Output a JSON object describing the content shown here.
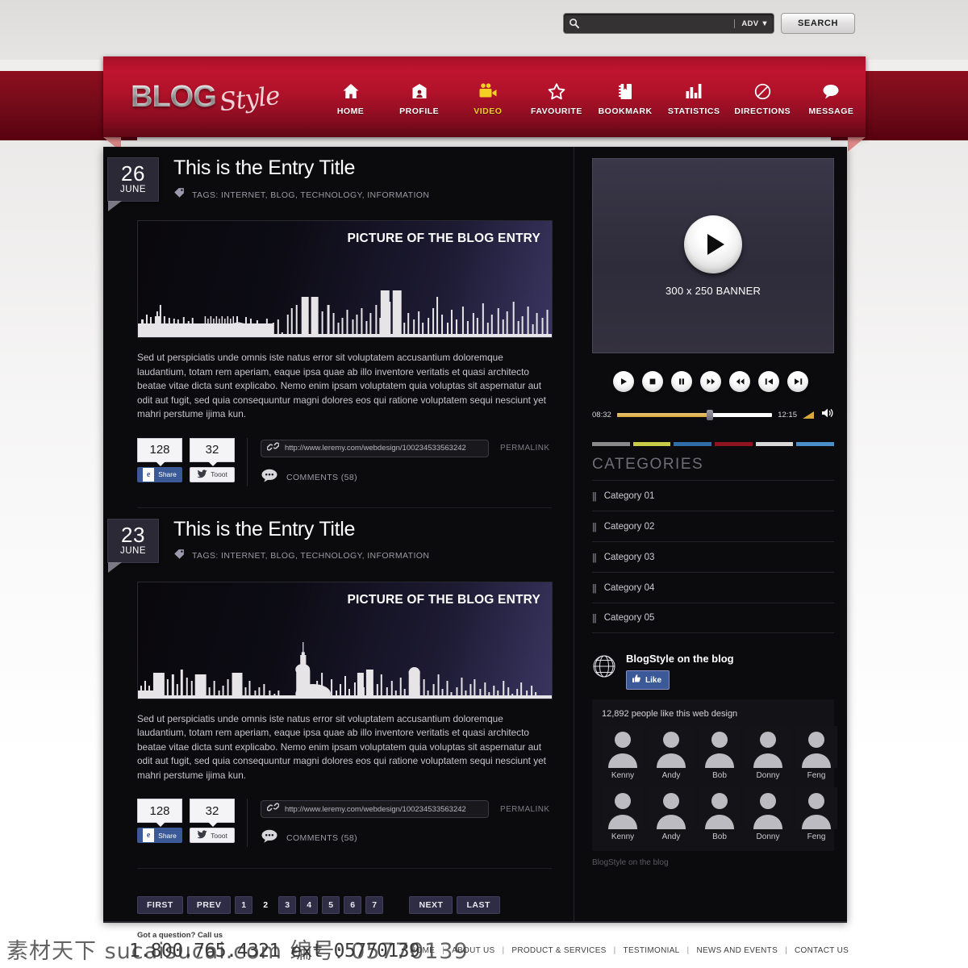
{
  "topbar": {
    "search_placeholder": "",
    "search_value": "",
    "adv_label": "ADV ▼",
    "search_button": "SEARCH",
    "search_icon": "magnifier-icon"
  },
  "header": {
    "logo_main": "BLOG",
    "logo_script": "Style",
    "nav": [
      {
        "label": "HOME",
        "icon": "home-icon",
        "active": false
      },
      {
        "label": "PROFILE",
        "icon": "profile-card-icon",
        "active": false
      },
      {
        "label": "VIDEO",
        "icon": "video-camera-icon",
        "active": true
      },
      {
        "label": "FAVOURITE",
        "icon": "star-icon",
        "active": false
      },
      {
        "label": "BOOKMARK",
        "icon": "notebook-icon",
        "active": false
      },
      {
        "label": "STATISTICS",
        "icon": "bar-chart-icon",
        "active": false
      },
      {
        "label": "DIRECTIONS",
        "icon": "no-entry-sign-icon",
        "active": false
      },
      {
        "label": "MESSAGE",
        "icon": "speech-bubble-icon",
        "active": false
      }
    ],
    "accent_color": "#b01229",
    "active_color": "#f5d024"
  },
  "entries": [
    {
      "day": "26",
      "month": "JUNE",
      "title": "This is the Entry Title",
      "tags": "TAGS: INTERNET, BLOG, TECHNOLOGY, INFORMATION",
      "picture_label": "PICTURE OF THE BLOG ENTRY",
      "skyline": "nyc",
      "body": "Sed ut perspiciatis unde omnis iste natus error sit voluptatem accusantium doloremque laudantium, totam rem aperiam, eaque ipsa quae ab illo inventore veritatis et quasi architecto beatae vitae dicta sunt explicabo. Nemo enim ipsam voluptatem quia voluptas sit aspernatur aut odit aut fugit, sed quia consequuntur magni dolores eos qui ratione voluptatem sequi nesciunt yet mahri perstume ijima kun.",
      "share_count": "128",
      "share_label": "Share",
      "toot_count": "32",
      "toot_label": "Tooot",
      "permalink_url": "http://www.leremy.com/webdesign/100234533563242",
      "permalink_label": "PERMALINK",
      "comments_label": "COMMENTS (58)"
    },
    {
      "day": "23",
      "month": "JUNE",
      "title": "This is the Entry Title",
      "tags": "TAGS: INTERNET, BLOG, TECHNOLOGY, INFORMATION",
      "picture_label": "PICTURE OF THE BLOG ENTRY",
      "skyline": "tower",
      "body": "Sed ut perspiciatis unde omnis iste natus error sit voluptatem accusantium doloremque laudantium, totam rem aperiam, eaque ipsa quae ab illo inventore veritatis et quasi architecto beatae vitae dicta sunt explicabo. Nemo enim ipsam voluptatem quia voluptas sit aspernatur aut odit aut fugit, sed quia consequuntur magni dolores eos qui ratione voluptatem sequi nesciunt yet mahri perstume ijima kun.",
      "share_count": "128",
      "share_label": "Share",
      "toot_count": "32",
      "toot_label": "Tooot",
      "permalink_url": "http://www.leremy.com/webdesign/100234533563242",
      "permalink_label": "PERMALINK",
      "comments_label": "COMMENTS (58)"
    }
  ],
  "pagination": {
    "first": "FIRST",
    "prev": "PREV",
    "pages": [
      "1",
      "2",
      "3",
      "4",
      "5",
      "6",
      "7"
    ],
    "current": "2",
    "next": "NEXT",
    "last": "LAST"
  },
  "sidebar": {
    "banner_label": "300 x 250 BANNER",
    "player": {
      "buttons": [
        "play-icon",
        "stop-icon",
        "pause-icon",
        "fast-forward-icon",
        "rewind-icon",
        "skip-back-icon",
        "skip-forward-icon"
      ],
      "time_current": "08:32",
      "time_total": "12:15",
      "volume_icon": "speaker-icon"
    },
    "color_bar": [
      "#8a8a8a",
      "#c9cc46",
      "#2f6ea8",
      "#8e1420",
      "#d8d8d8",
      "#4a8fc9"
    ],
    "categories_title": "CATEGORIES",
    "categories": [
      "Category 01",
      "Category 02",
      "Category 03",
      "Category 04",
      "Category 05"
    ],
    "social": {
      "title": "BlogStyle on the blog",
      "like_label": "Like",
      "like_icon": "thumbs-up-icon",
      "globe_icon": "globe-icon",
      "count_text": "12,892 people like this web design",
      "faces": [
        "Kenny",
        "Andy",
        "Bob",
        "Donny",
        "Feng",
        "Kenny",
        "Andy",
        "Bob",
        "Donny",
        "Feng"
      ],
      "footer_text": "BlogStyle on the blog"
    }
  },
  "footer": {
    "call_text": "Got a question? Call us",
    "phone": "1.800.765.4321 ext 05770139",
    "links": [
      "HOME",
      "ABOUT US",
      "PRODUCT & SERVICES",
      "TESTIMONIAL",
      "NEWS AND EVENTS",
      "CONTACT US"
    ]
  },
  "watermark": "素材天下 sucaisucai.com 编号: 05770139"
}
